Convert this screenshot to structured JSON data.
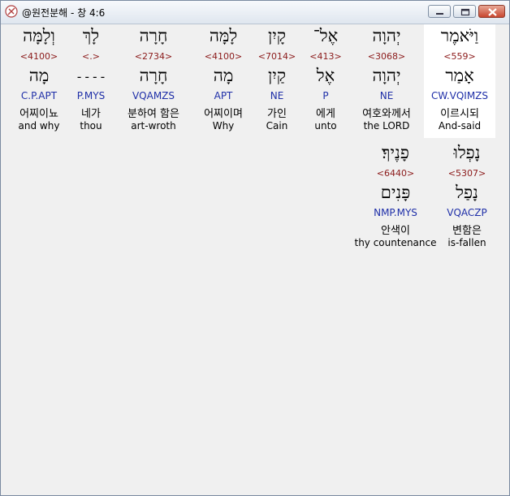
{
  "window": {
    "title": "@원전분해 - 창 4:6"
  },
  "words": [
    {
      "hebrew": "וַיֹּאמֶר",
      "strong": "<559>",
      "lemma": "אָמַר",
      "morph": "CW.VQIMZS",
      "korean": "이르시되",
      "english": "And-said",
      "highlight": true
    },
    {
      "hebrew": "יְהוָה",
      "strong": "<3068>",
      "lemma": "יְהוָה",
      "morph": "NE",
      "korean": "여호와께서",
      "english": "the LORD"
    },
    {
      "hebrew": "אֶל־",
      "strong": "<413>",
      "lemma": "אֶל",
      "morph": "P",
      "korean": "에게",
      "english": "unto"
    },
    {
      "hebrew": "קָיִן",
      "strong": "<7014>",
      "lemma": "קַיִן",
      "morph": "NE",
      "korean": "가인",
      "english": "Cain"
    },
    {
      "hebrew": "לָמָּה",
      "strong": "<4100>",
      "lemma": "מָה",
      "morph": "APT",
      "korean": "어찌이며",
      "english": "Why"
    },
    {
      "hebrew": "חָרָה",
      "strong": "<2734>",
      "lemma": "חָרָה",
      "morph": "VQAMZS",
      "korean": "분하여 함은",
      "english": "art-wroth"
    },
    {
      "hebrew": "לָךְ",
      "strong": "<.>",
      "lemma": "----",
      "morph": "P.MYS",
      "korean": "네가",
      "english": "thou"
    },
    {
      "hebrew": "וְלָמָּה",
      "strong": "<4100>",
      "lemma": "מָה",
      "morph": "C.P.APT",
      "korean": "어찌이뇨",
      "english": "and why"
    },
    {
      "hebrew": "נָפְלוּ",
      "strong": "<5307>",
      "lemma": "נָפַל",
      "morph": "VQACZP",
      "korean": "변함은",
      "english": "is-fallen"
    },
    {
      "hebrew": "פָנֶיךָ׃",
      "strong": "<6440>",
      "lemma": "פָּנִים",
      "morph": "NMP.MYS",
      "korean": "안색이",
      "english": "thy countenance"
    }
  ]
}
